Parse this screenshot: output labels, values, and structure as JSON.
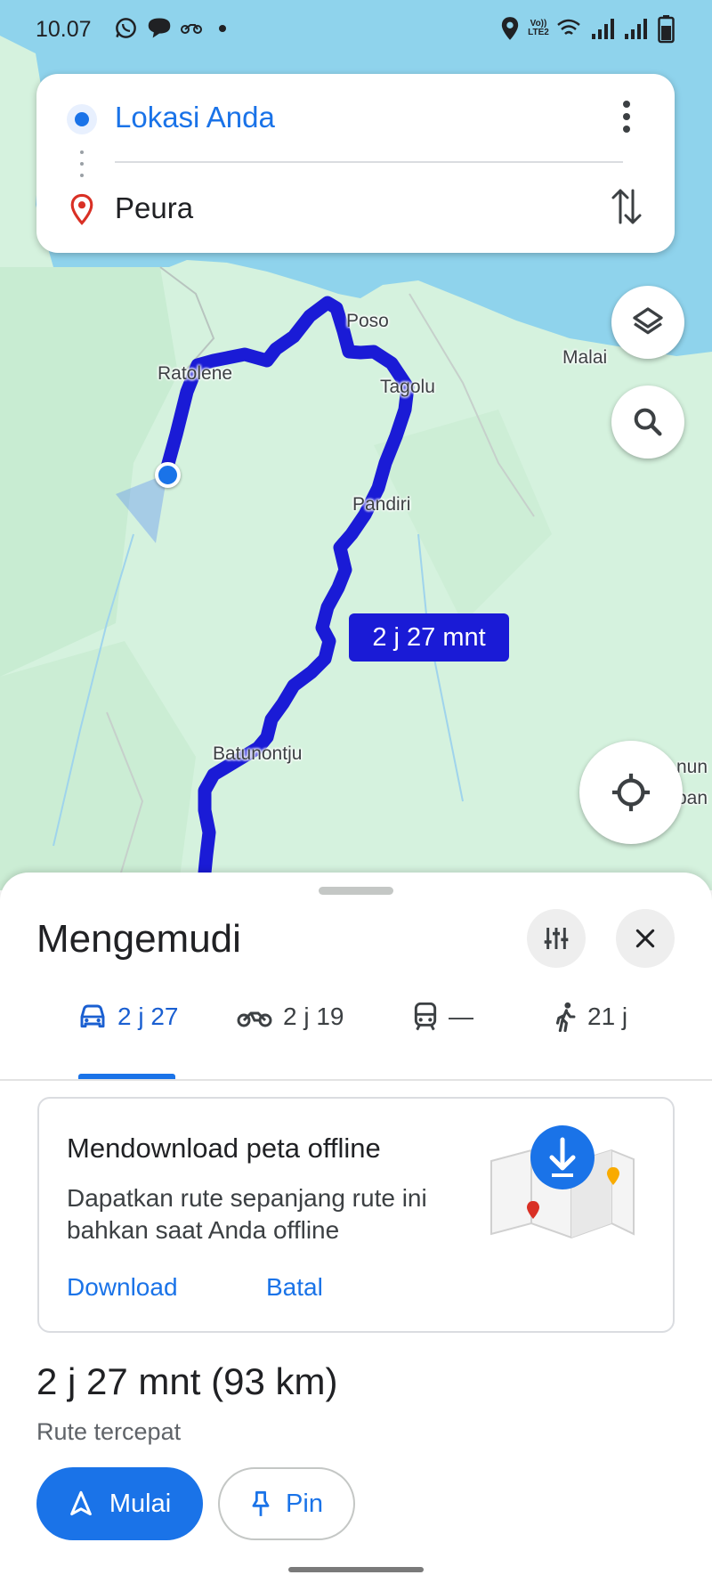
{
  "status_bar": {
    "time": "10.07",
    "icons": [
      "whatsapp-icon",
      "message-icon",
      "motorbike-icon",
      "dot-icon",
      "location-icon",
      "volte-icon",
      "wifi-icon",
      "signal-icon",
      "signal-icon",
      "battery-icon"
    ],
    "volte_text": "Vo)) LTE2"
  },
  "search": {
    "origin": "Lokasi Anda",
    "destination": "Peura"
  },
  "map": {
    "places": [
      "Poso",
      "Malai",
      "Ratolene",
      "Tagolu",
      "Pandiri",
      "Batunontju",
      "nun",
      "pan"
    ],
    "route_time_label": "2 j 27 mnt",
    "route_color": "#1a1bd6",
    "water_color": "#8fd3ec",
    "land_color": "#d5f2de"
  },
  "sheet": {
    "title": "Mengemudi",
    "tabs": [
      {
        "icon": "car-icon",
        "label": "2 j 27",
        "active": true
      },
      {
        "icon": "motorbike-icon",
        "label": "2 j 19",
        "active": false
      },
      {
        "icon": "train-icon",
        "label": "—",
        "active": false
      },
      {
        "icon": "walk-icon",
        "label": "21 j",
        "active": false
      }
    ],
    "offline_card": {
      "title": "Mendownload peta offline",
      "body": "Dapatkan rute sepanjang rute ini bahkan saat Anda offline",
      "download_label": "Download",
      "cancel_label": "Batal"
    },
    "summary_time": "2 j 27 mnt",
    "summary_distance": "(93 km)",
    "route_subtitle": "Rute tercepat",
    "start_label": "Mulai",
    "pin_label": "Pin"
  },
  "colors": {
    "accent": "#1a73e8",
    "dest_pin": "#d93025"
  }
}
